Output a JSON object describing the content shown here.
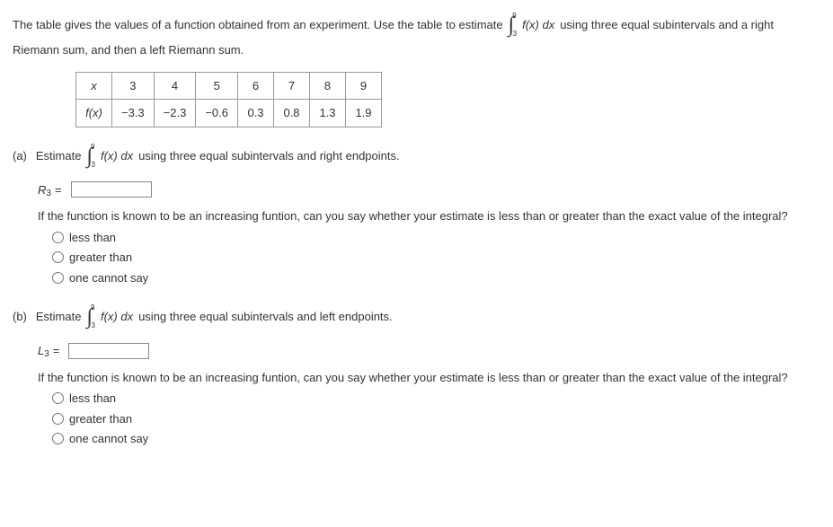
{
  "intro": {
    "text1": "The table gives the values of a function obtained from an experiment. Use the table to estimate",
    "integral_upper": "9",
    "integral_lower": "3",
    "integrand": "f(x) dx",
    "text2": "using three equal subintervals and a right",
    "text3": "Riemann sum, and then a left Riemann sum."
  },
  "table": {
    "row1": [
      "x",
      "3",
      "4",
      "5",
      "6",
      "7",
      "8",
      "9"
    ],
    "row2": [
      "f(x)",
      "−3.3",
      "−2.3",
      "−0.6",
      "0.3",
      "0.8",
      "1.3",
      "1.9"
    ]
  },
  "partA": {
    "label": "(a)",
    "estimate_text": "Estimate",
    "integral_upper": "9",
    "integral_lower": "3",
    "integrand": "f(x) dx",
    "tail": "using three equal subintervals and right endpoints.",
    "var": "R",
    "sub": "3",
    "eq": "=",
    "followup": "If the function is known to be an increasing funtion, can you say whether your estimate is less than or greater than the exact value of the integral?",
    "options": [
      "less than",
      "greater than",
      "one cannot say"
    ]
  },
  "partB": {
    "label": "(b)",
    "estimate_text": "Estimate",
    "integral_upper": "9",
    "integral_lower": "3",
    "integrand": "f(x) dx",
    "tail": "using three equal subintervals and left endpoints.",
    "var": "L",
    "sub": "3",
    "eq": "=",
    "followup": "If the function is known to be an increasing funtion, can you say whether your estimate is less than or greater than the exact value of the integral?",
    "options": [
      "less than",
      "greater than",
      "one cannot say"
    ]
  }
}
